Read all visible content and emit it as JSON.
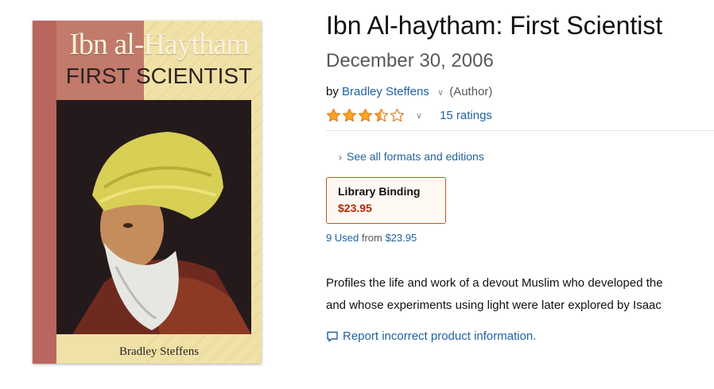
{
  "cover": {
    "title_line1": "Ibn al-Haytham",
    "title_line2": "FIRST SCIENTIST",
    "author": "Bradley Steffens"
  },
  "product": {
    "title": "Ibn Al-haytham: First Scientist",
    "date": "December 30, 2006",
    "by_label": "by",
    "author": "Bradley Steffens",
    "author_role": "(Author)",
    "rating_stars": 3.5,
    "ratings_count": "15 ratings",
    "formats_link": "See all formats and editions",
    "binding": {
      "name": "Library Binding",
      "price": "$23.95"
    },
    "used": {
      "count": "9 Used",
      "from_label": "from",
      "price": "$23.95"
    },
    "description": [
      "Profiles the life and work of a devout Muslim who developed the",
      "and whose experiments using light were later explored by Isaac"
    ],
    "report_link": "Report incorrect product information."
  },
  "colors": {
    "link": "#2162a1",
    "price": "#b12704",
    "star": "#ffa41c",
    "selected_border": "#c7511f"
  },
  "icons": [
    "chevron-down-icon",
    "star-icon",
    "caret-right-icon",
    "feedback-bubble-icon"
  ]
}
